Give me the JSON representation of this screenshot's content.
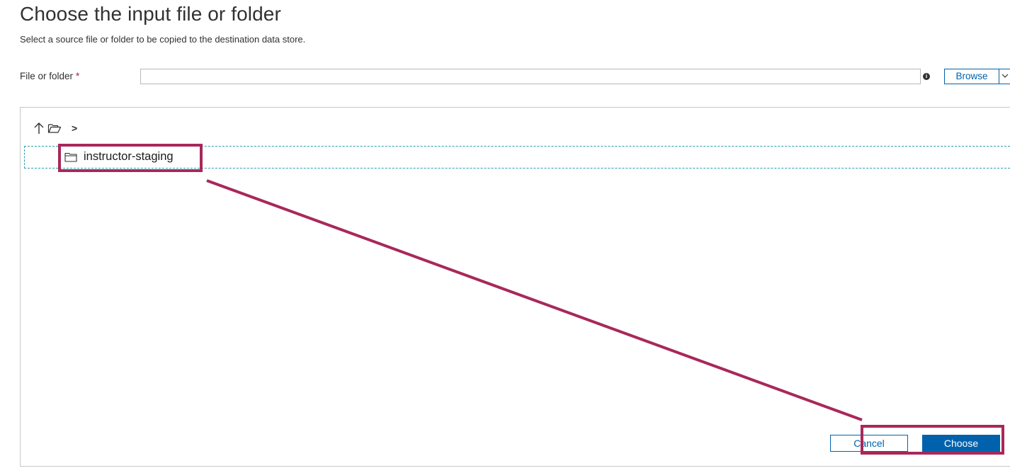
{
  "dialog": {
    "title": "Choose the input file or folder",
    "subtitle": "Select a source file or folder to be copied to the destination data store."
  },
  "path_field": {
    "label": "File or folder",
    "required_mark": "*",
    "value": "",
    "placeholder": ""
  },
  "toolbar": {
    "browse_label": "Browse",
    "breadcrumb_separator": ">"
  },
  "browser": {
    "items": [
      {
        "name": "instructor-staging",
        "type": "folder"
      }
    ]
  },
  "actions": {
    "cancel_label": "Cancel",
    "choose_label": "Choose"
  },
  "annotation": {
    "color": "#a8285a"
  },
  "colors": {
    "accent": "#0062ad",
    "selection_dash": "#2b9fb5",
    "required": "#a4262c"
  },
  "icons": [
    "info-icon",
    "chevron-down-icon",
    "arrow-up-icon",
    "folder-open-icon",
    "folder-icon"
  ]
}
